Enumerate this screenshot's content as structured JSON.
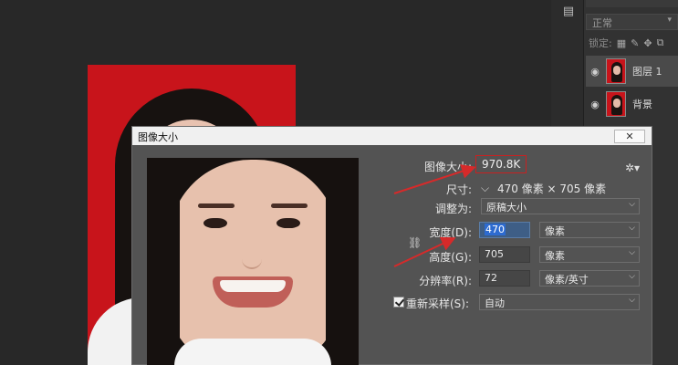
{
  "layers_panel": {
    "blend_mode": "正常",
    "lock_label": "锁定:",
    "layers": [
      {
        "name": "图层 1",
        "selected": true
      },
      {
        "name": "背景",
        "selected": false
      }
    ]
  },
  "dialog": {
    "title": "图像大小",
    "close_label": "✕",
    "image_size_label": "图像大小:",
    "image_size_value": "970.8K",
    "dimensions_label": "尺寸:",
    "dimensions_value": "470 像素 × 705 像素",
    "fit_to_label": "调整为:",
    "fit_to_value": "原稿大小",
    "width_label": "宽度(D):",
    "width_value": "470",
    "width_unit": "像素",
    "height_label": "高度(G):",
    "height_value": "705",
    "height_unit": "像素",
    "resolution_label": "分辨率(R):",
    "resolution_value": "72",
    "resolution_unit": "像素/英寸",
    "resample_label": "重新采样(S):",
    "resample_checked": true,
    "resample_value": "自动"
  },
  "colors": {
    "photo_bg": "#c8141b",
    "highlight_box": "#c82121",
    "arrow": "#d62a2a"
  }
}
